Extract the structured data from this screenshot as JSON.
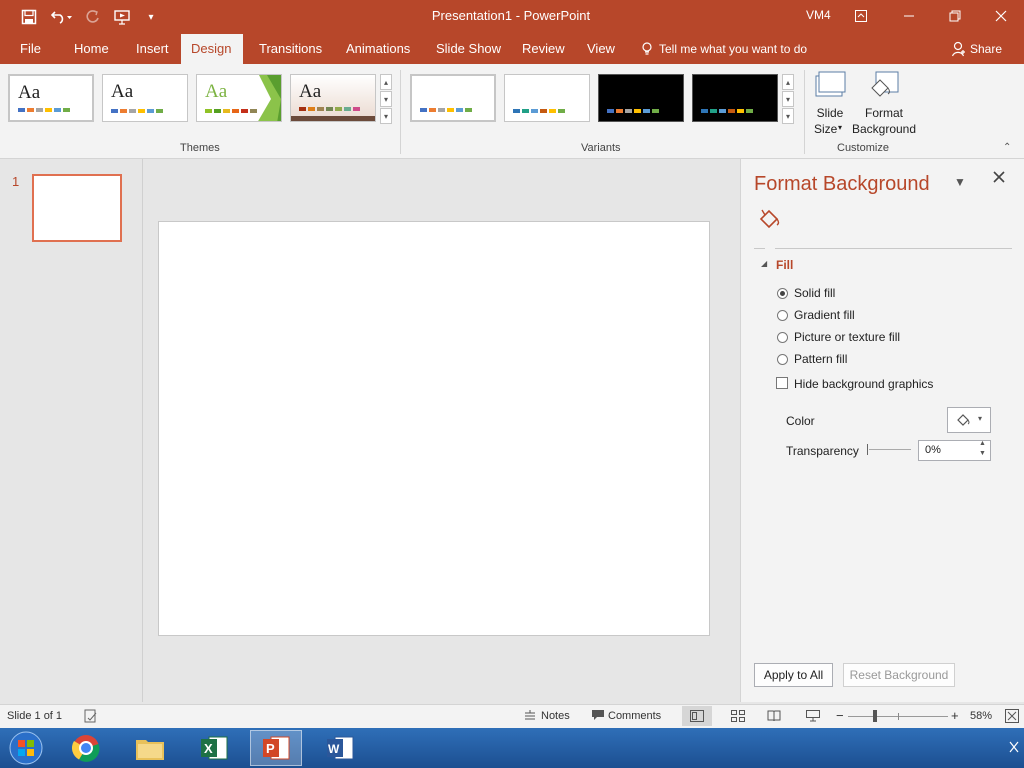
{
  "window": {
    "title": "Presentation1  -  PowerPoint",
    "user": "VM4"
  },
  "tabs": [
    {
      "label": "File"
    },
    {
      "label": "Home"
    },
    {
      "label": "Insert"
    },
    {
      "label": "Design"
    },
    {
      "label": "Transitions"
    },
    {
      "label": "Animations"
    },
    {
      "label": "Slide Show"
    },
    {
      "label": "Review"
    },
    {
      "label": "View"
    }
  ],
  "tell_me": "Tell me what you want to do",
  "share": "Share",
  "ribbon": {
    "themes_label": "Themes",
    "variants_label": "Variants",
    "customize_label": "Customize",
    "theme_aa": "Aa",
    "slide_size_line1": "Slide",
    "slide_size_line2": "Size",
    "format_bg_line1": "Format",
    "format_bg_line2": "Background"
  },
  "slides_pane": {
    "slide_number": "1"
  },
  "format_background": {
    "title": "Format Background",
    "section": "Fill",
    "options": [
      {
        "label": "Solid fill"
      },
      {
        "label": "Gradient fill"
      },
      {
        "label": "Picture or texture fill"
      },
      {
        "label": "Pattern fill"
      }
    ],
    "selected_option": "Solid fill",
    "hide_bg_label": "Hide background graphics",
    "color_label": "Color",
    "transparency_label": "Transparency",
    "transparency_value": "0%",
    "apply_all": "Apply to All",
    "reset": "Reset Background"
  },
  "status": {
    "slide_info": "Slide 1 of 1",
    "notes": "Notes",
    "comments": "Comments",
    "zoom": "58%"
  },
  "colors": {
    "accent": "#b7472a"
  }
}
